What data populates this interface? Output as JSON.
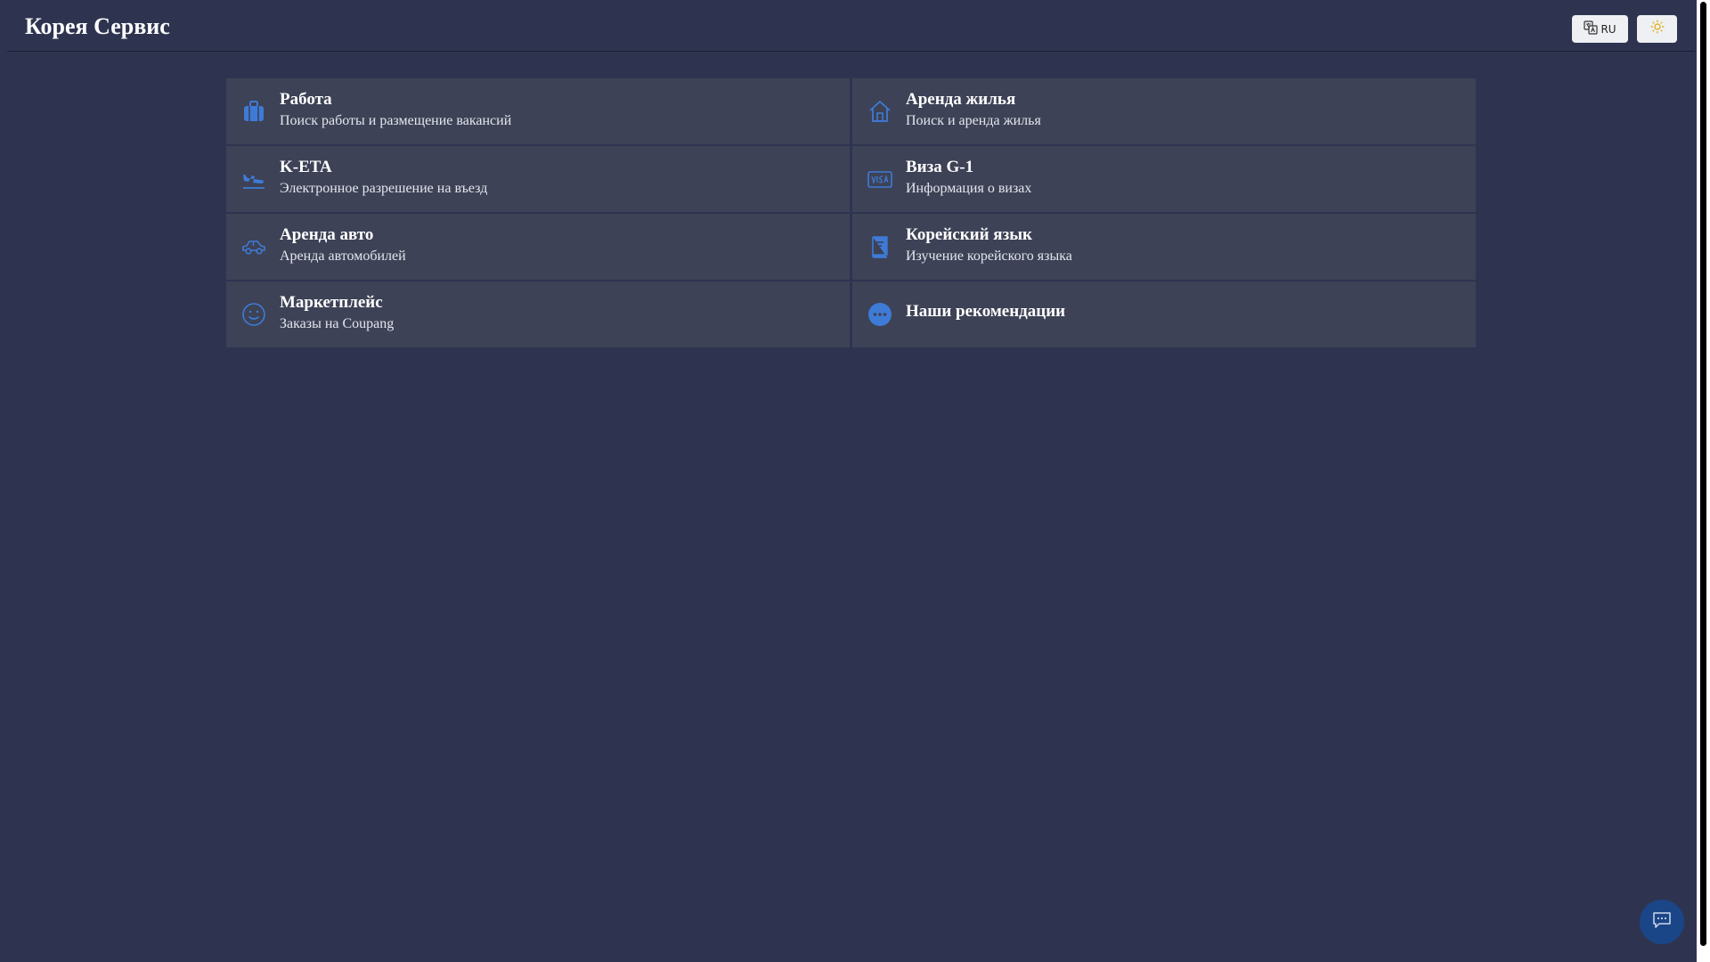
{
  "header": {
    "title": "Корея Сервис",
    "language_label": "RU",
    "language_icon": "translate-icon",
    "theme_icon": "sun-icon"
  },
  "services": [
    {
      "title": "Работа",
      "subtitle": "Поиск работы и размещение вакансий",
      "icon": "briefcase-icon"
    },
    {
      "title": "Аренда жилья",
      "subtitle": "Поиск и аренда жилья",
      "icon": "house-icon"
    },
    {
      "title": "K-ETA",
      "subtitle": "Электронное разрешение на въезд",
      "icon": "airplane-icon"
    },
    {
      "title": "Виза G-1",
      "subtitle": "Информация о визах",
      "icon": "visa-card-icon"
    },
    {
      "title": "Аренда авто",
      "subtitle": "Аренда автомобилей",
      "icon": "car-icon"
    },
    {
      "title": "Корейский язык",
      "subtitle": "Изучение корейского языка",
      "icon": "book-icon"
    },
    {
      "title": "Маркетплейс",
      "subtitle": "Заказы на Coupang",
      "icon": "smiley-icon"
    },
    {
      "title": "Наши рекомендации",
      "subtitle": "",
      "icon": "more-dots-icon"
    }
  ],
  "colors": {
    "background": "#2e3450",
    "card": "#3d4256",
    "icon_accent": "#3e7bd6",
    "chat_button": "#1a4688"
  },
  "chat": {
    "icon": "chat-bubble-icon"
  }
}
